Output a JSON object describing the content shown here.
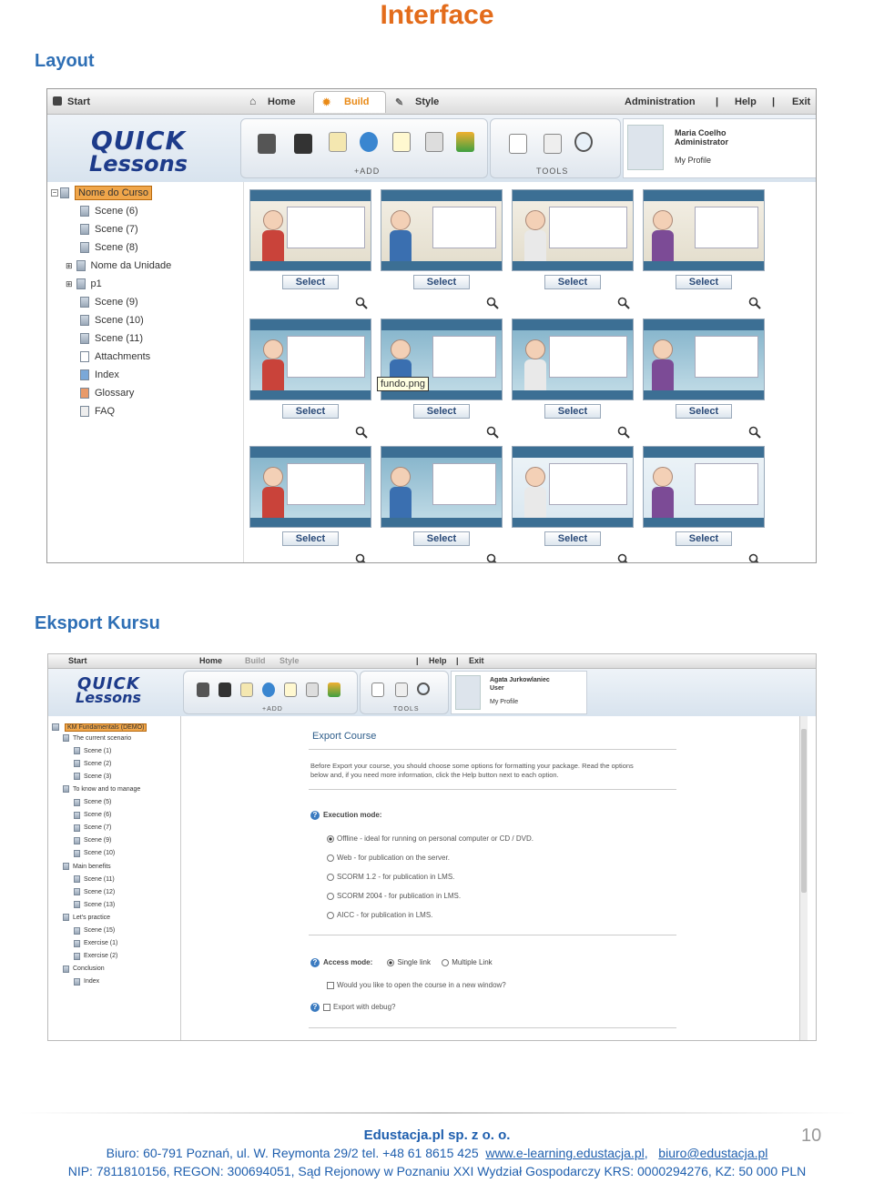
{
  "header": {
    "title": "Interface"
  },
  "sections": {
    "layout": "Layout",
    "export": "Eksport Kursu"
  },
  "app": {
    "logo_top": "QUICK",
    "logo_bottom": "Lessons",
    "menu": {
      "start": "Start",
      "home": "Home",
      "build": "Build",
      "style": "Style",
      "administration": "Administration",
      "help": "Help",
      "exit": "Exit",
      "sep": "|"
    },
    "panels": {
      "add": "+ADD",
      "tools": "TOOLS"
    },
    "profile": {
      "name": "Maria Coelho",
      "role": "Administrator",
      "link": "My Profile"
    },
    "tree": {
      "root": "Nome do Curso",
      "items": [
        "Scene (6)",
        "Scene (7)",
        "Scene (8)",
        "Nome da Unidade",
        "p1",
        "Scene (9)",
        "Scene (10)",
        "Scene (11)",
        "Attachments",
        "Index",
        "Glossary",
        "FAQ"
      ]
    },
    "select_label": "Select",
    "tooltip": "fundo.png"
  },
  "export_app": {
    "menu": {
      "start": "Start",
      "home": "Home",
      "build": "Build",
      "style": "Style",
      "help": "Help",
      "exit": "Exit",
      "sep": "|"
    },
    "panels": {
      "add": "+ADD",
      "tools": "TOOLS"
    },
    "profile": {
      "name": "Agata Jurkowlaniec",
      "role": "User",
      "link": "My Profile"
    },
    "tree": {
      "root": "KM Fundamentals (DEMO)",
      "items": [
        "The current scenario",
        "Scene (1)",
        "Scene (2)",
        "Scene (3)",
        "To know and to manage",
        "Scene (5)",
        "Scene (6)",
        "Scene (7)",
        "Scene (9)",
        "Scene (10)",
        "Main benefits",
        "Scene (11)",
        "Scene (12)",
        "Scene (13)",
        "Let's practice",
        "Scene (15)",
        "Exercise (1)",
        "Exercise (2)",
        "Conclusion",
        "Index"
      ]
    },
    "panel": {
      "title": "Export Course",
      "intro_1": "Before Export your course, you should choose some options for formatting your package. Read the options",
      "intro_2": "below and, if you need more information, click the Help button next to each option.",
      "execution_label": "Execution mode:",
      "modes": [
        "Offline - ideal for running on personal computer or CD / DVD.",
        "Web - for publication on the server.",
        "SCORM 1.2 - for publication in LMS.",
        "SCORM 2004 - for publication in LMS.",
        "AICC - for publication in LMS."
      ],
      "selected_mode": 0,
      "access_label": "Access mode:",
      "access_single": "Single link",
      "access_multiple": "Multiple Link",
      "new_window": "Would you like to open the course in a new window?",
      "debug": "Export with debug?"
    }
  },
  "footer": {
    "company": "Edustacja.pl sp. z o. o.",
    "address": "Biuro: 60-791 Poznań, ul. W. Reymonta 29/2  tel. +48 61 8615 425",
    "website": "www.e-learning.edustacja.pl",
    "comma": ",",
    "email": "biuro@edustacja.pl",
    "legal": "NIP: 7811810156,  REGON: 300694051,  Sąd Rejonowy w Poznaniu XXI Wydział Gospodarczy  KRS: 0000294276,  KZ: 50 000 PLN",
    "page": "10"
  },
  "colors": {
    "title": "#e36c1b",
    "heading": "#2e6fb5",
    "footer": "#1f5fae"
  }
}
